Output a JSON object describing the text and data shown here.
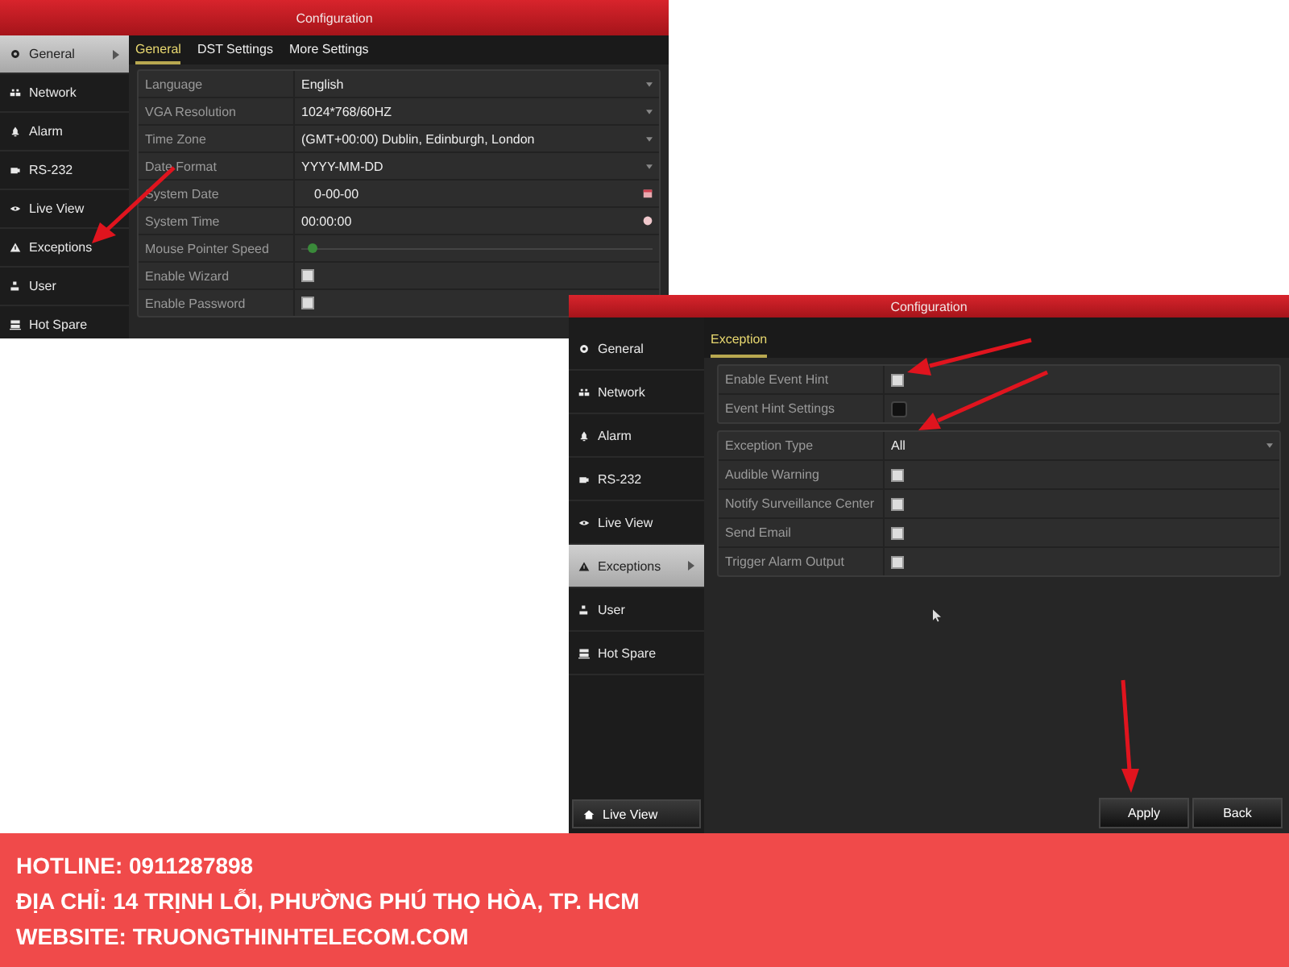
{
  "screens": [
    {
      "title": "Configuration",
      "sidebar": [
        {
          "label": "General",
          "selected": true
        },
        {
          "label": "Network",
          "selected": false
        },
        {
          "label": "Alarm",
          "selected": false
        },
        {
          "label": "RS-232",
          "selected": false
        },
        {
          "label": "Live View",
          "selected": false
        },
        {
          "label": "Exceptions",
          "selected": false
        },
        {
          "label": "User",
          "selected": false
        },
        {
          "label": "Hot Spare",
          "selected": false
        }
      ],
      "tabs": [
        {
          "label": "General",
          "selected": true
        },
        {
          "label": "DST Settings",
          "selected": false
        },
        {
          "label": "More Settings",
          "selected": false
        }
      ],
      "groups": [
        {
          "rows": [
            {
              "label": "Language",
              "kind": "dropdown",
              "value": "English"
            },
            {
              "label": "VGA Resolution",
              "kind": "dropdown",
              "value": "1024*768/60HZ"
            },
            {
              "label": "Time Zone",
              "kind": "dropdown",
              "value": "(GMT+00:00) Dublin, Edinburgh, London"
            },
            {
              "label": "Date Format",
              "kind": "dropdown",
              "value": "YYYY-MM-DD"
            },
            {
              "label": "System Date",
              "kind": "date",
              "value": "0-00-00"
            },
            {
              "label": "System Time",
              "kind": "time",
              "value": "00:00:00"
            },
            {
              "label": "Mouse Pointer Speed",
              "kind": "slider",
              "level": 0.02
            },
            {
              "label": "Enable Wizard",
              "kind": "checkbox",
              "checked": false
            },
            {
              "label": "Enable Password",
              "kind": "checkbox",
              "checked": false
            }
          ]
        }
      ]
    },
    {
      "title": "Configuration",
      "sidebar": [
        {
          "label": "General",
          "selected": false
        },
        {
          "label": "Network",
          "selected": false
        },
        {
          "label": "Alarm",
          "selected": false
        },
        {
          "label": "RS-232",
          "selected": false
        },
        {
          "label": "Live View",
          "selected": false
        },
        {
          "label": "Exceptions",
          "selected": true
        },
        {
          "label": "User",
          "selected": false
        },
        {
          "label": "Hot Spare",
          "selected": false
        }
      ],
      "tabs": [
        {
          "label": "Exception",
          "selected": true
        }
      ],
      "groups": [
        {
          "rows": [
            {
              "label": "Enable Event Hint",
              "kind": "checkbox",
              "checked": false
            },
            {
              "label": "Event Hint Settings",
              "kind": "settings"
            }
          ]
        },
        {
          "rows": [
            {
              "label": "Exception Type",
              "kind": "dropdown",
              "value": "All"
            },
            {
              "label": "Audible Warning",
              "kind": "checkbox",
              "checked": false
            },
            {
              "label": "Notify Surveillance Center",
              "kind": "checkbox",
              "checked": false
            },
            {
              "label": "Send Email",
              "kind": "checkbox",
              "checked": false
            },
            {
              "label": "Trigger Alarm Output",
              "kind": "checkbox",
              "checked": false
            }
          ]
        }
      ],
      "sidebar_button": "Live View",
      "buttons": [
        "Apply",
        "Back"
      ]
    }
  ],
  "footer": [
    "HOTLINE: 0911287898",
    "ĐỊA CHỈ: 14 TRỊNH LỖI, PHƯỜNG PHÚ THỌ HÒA, TP. HCM",
    "WEBSITE: TRUONGTHINHTELECOM.COM"
  ]
}
